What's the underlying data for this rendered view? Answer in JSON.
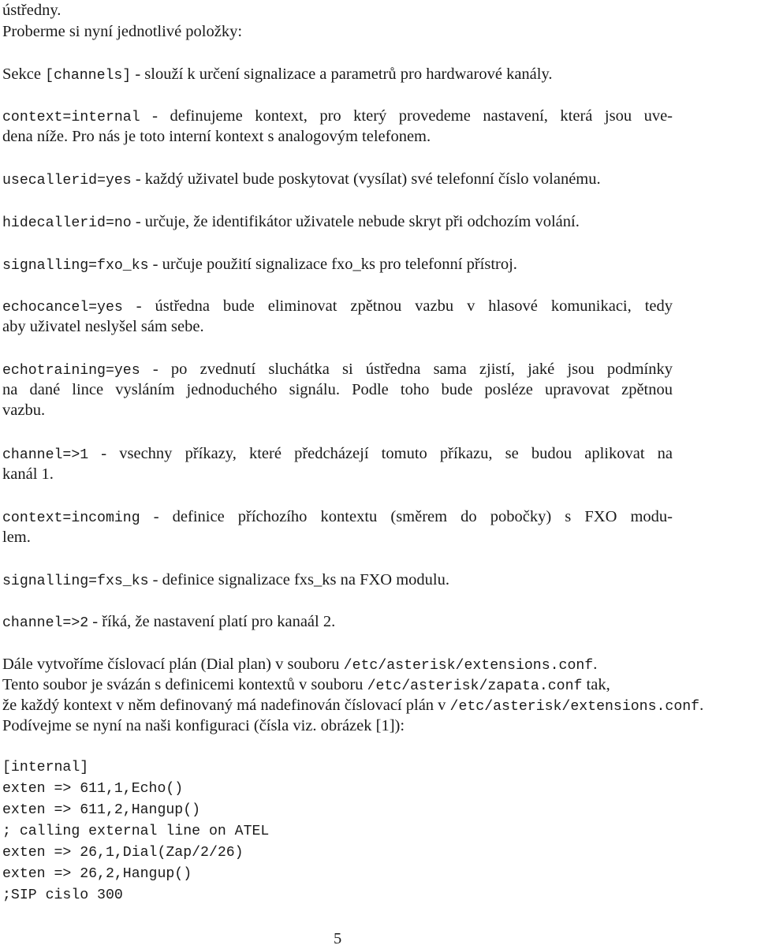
{
  "document": {
    "intro": {
      "line1": "ústředny.",
      "line2": "Proberme si nyní jednotlivé položky:"
    },
    "section": {
      "prefix": "Sekce ",
      "code": "[channels]",
      "text": " - slouží k určení signalizace a parametrů pro hardwarové kanály."
    },
    "items": [
      {
        "code": "context=internal",
        "lines": [
          " - definujeme kontext, pro který provedeme nastavení, která jsou uve-",
          "dena níže. Pro nás je toto interní kontext s analogovým telefonem."
        ]
      },
      {
        "code": "usecallerid=yes",
        "lines": [
          " - každý uživatel bude poskytovat (vysílat) své telefonní číslo volanému."
        ]
      },
      {
        "code": "hidecallerid=no",
        "lines": [
          " - určuje, že identifikátor uživatele nebude skryt při odchozím volání."
        ]
      },
      {
        "code": "signalling=fxo_ks",
        "lines": [
          " - určuje použití signalizace fxo_ks pro telefonní přístroj."
        ]
      },
      {
        "code": "echocancel=yes",
        "lines": [
          " - ústředna bude eliminovat zpětnou vazbu v hlasové komunikaci, tedy",
          "aby uživatel neslyšel sám sebe."
        ]
      },
      {
        "code": "echotraining=yes",
        "lines": [
          " - po zvednutí sluchátka si ústředna sama zjistí, jaké jsou podmínky",
          "na dané lince vysláním jednoduchého signálu. Podle toho bude posléze upravovat zpětnou",
          "vazbu."
        ]
      },
      {
        "code": "channel=>1",
        "lines": [
          " - vsechny příkazy, které předcházejí tomuto příkazu, se budou aplikovat na",
          "kanál 1."
        ]
      },
      {
        "code": "context=incoming",
        "lines": [
          " - definice příchozího kontextu (směrem do pobočky) s FXO modu-",
          "lem."
        ]
      },
      {
        "code": "signalling=fxs_ks",
        "lines": [
          " - definice signalizace fxs_ks na FXO modulu."
        ]
      },
      {
        "code": "channel=>2",
        "lines": [
          " - říká, že nastavení platí pro kanaál 2."
        ]
      }
    ],
    "dialplan": {
      "l1_text": "Dále vytvoříme číslovací plán (Dial plan) v souboru ",
      "l1_code": "/etc/asterisk/extensions.conf",
      "l1_end": ".",
      "l2_text": "Tento soubor je svázán s definicemi kontextů v souboru ",
      "l2_code": "/etc/asterisk/zapata.conf",
      "l2_end": " tak,",
      "l3_text": "že každý kontext v něm definovaný má nadefinován číslovací plán v ",
      "l3_code": "/etc/asterisk/extensions.conf",
      "l3_end": ".",
      "l4_text": "Podívejme se nyní na naši konfiguraci (čísla viz. obrázek [1]):"
    },
    "code_listing": [
      "[internal]",
      "exten => 611,1,Echo()",
      "exten => 611,2,Hangup()",
      "; calling external line on ATEL",
      "exten => 26,1,Dial(Zap/2/26)",
      "exten => 26,2,Hangup()",
      ";SIP cislo 300"
    ],
    "page_number": "5"
  }
}
